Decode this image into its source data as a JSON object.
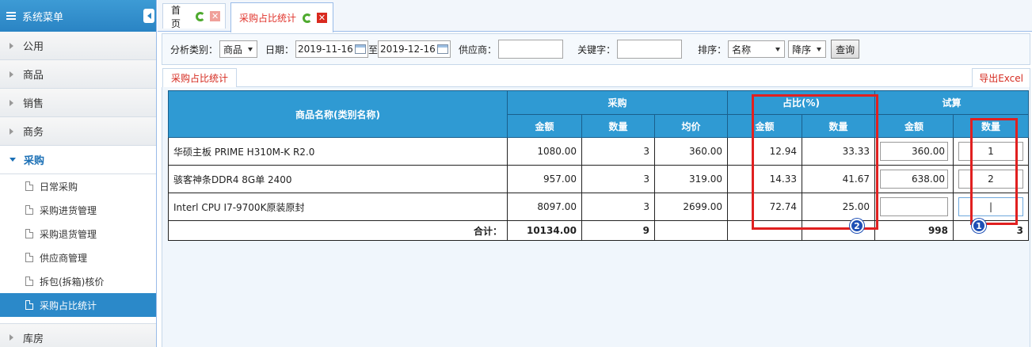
{
  "sidebar": {
    "title": "系统菜单",
    "sections": [
      "公用",
      "商品",
      "销售",
      "商务"
    ],
    "active_section": "采购",
    "sub_items": [
      "日常采购",
      "采购进货管理",
      "采购退货管理",
      "供应商管理",
      "拆包(拆箱)核价",
      "采购占比统计"
    ],
    "last_section": "库房"
  },
  "tabs": [
    {
      "label": "首页"
    },
    {
      "label": "采购占比统计"
    }
  ],
  "filter": {
    "category_label": "分析类别：",
    "category_value": "商品",
    "date_label": "日期：",
    "date_from": "2019-11-16",
    "date_to_label": "至",
    "date_to": "2019-12-16",
    "supplier_label": "供应商：",
    "keyword_label": "关键字：",
    "sort_label": "排序：",
    "sort_value": "名称",
    "order_value": "降序",
    "query_button": "查询"
  },
  "subtab": "采购占比统计",
  "export": "导出Excel",
  "table": {
    "headers": {
      "name": "商品名称(类别名称)",
      "purchase": "采购",
      "ratio": "占比(%)",
      "trial": "试算",
      "amount": "金额",
      "qty": "数量",
      "avg": "均价"
    },
    "rows": [
      {
        "name": "华硕主板 PRIME H310M-K R2.0",
        "amount": "1080.00",
        "qty": "3",
        "avg": "360.00",
        "ratio_amount": "12.94",
        "ratio_qty": "33.33",
        "trial_amount": "360.00",
        "trial_qty": "1"
      },
      {
        "name": "骇客神条DDR4 8G单 2400",
        "amount": "957.00",
        "qty": "3",
        "avg": "319.00",
        "ratio_amount": "14.33",
        "ratio_qty": "41.67",
        "trial_amount": "638.00",
        "trial_qty": "2"
      },
      {
        "name": "Interl CPU I7-9700K原装原封",
        "amount": "8097.00",
        "qty": "3",
        "avg": "2699.00",
        "ratio_amount": "72.74",
        "ratio_qty": "25.00",
        "trial_amount": "",
        "trial_qty": "|"
      }
    ],
    "total": {
      "label": "合计：",
      "amount": "10134.00",
      "qty": "9",
      "trial_amount": "998",
      "trial_qty": "3"
    }
  },
  "annotations": {
    "badge1": "1",
    "badge2": "2"
  },
  "colors": {
    "accent": "#2f9ad3",
    "highlight": "#e02020",
    "badge": "#1e4fb5"
  }
}
